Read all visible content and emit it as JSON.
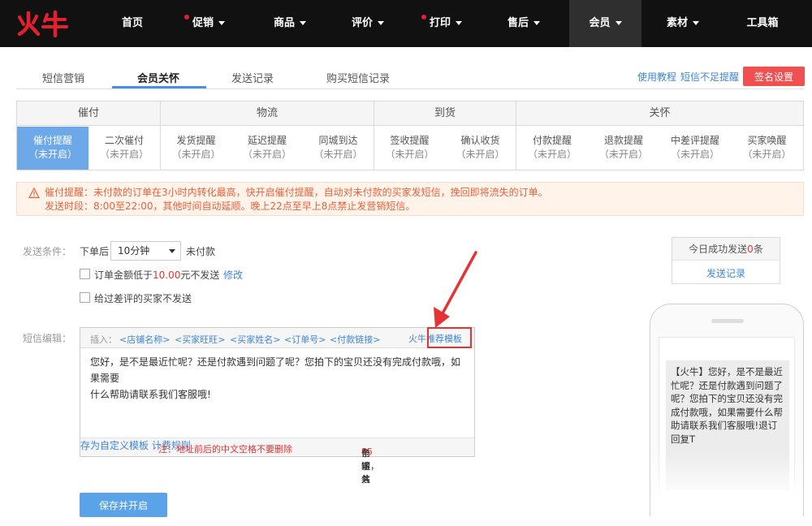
{
  "logo": {
    "text": "火牛"
  },
  "nav": {
    "items": [
      {
        "label": "首页"
      },
      {
        "label": "促销"
      },
      {
        "label": "商品"
      },
      {
        "label": "评价"
      },
      {
        "label": "打印"
      },
      {
        "label": "售后"
      },
      {
        "label": "会员"
      },
      {
        "label": "素材"
      },
      {
        "label": "工具箱"
      }
    ]
  },
  "tabs": [
    {
      "label": "短信营销"
    },
    {
      "label": "会员关怀"
    },
    {
      "label": "发送记录"
    },
    {
      "label": "购买短信记录"
    }
  ],
  "links": {
    "tutorial": "使用教程",
    "insufficient": "短信不足提醒"
  },
  "signature_button": "签名设置",
  "categories": {
    "groups": [
      {
        "name": "催付"
      },
      {
        "name": "物流"
      },
      {
        "name": "到货"
      },
      {
        "name": "关怀"
      }
    ],
    "items": [
      {
        "name": "催付提醒",
        "status": "（未开启）"
      },
      {
        "name": "二次催付",
        "status": "（未开启）"
      },
      {
        "name": "发货提醒",
        "status": "（未开启）"
      },
      {
        "name": "延迟提醒",
        "status": "（未开启）"
      },
      {
        "name": "同城到达",
        "status": "（未开启）"
      },
      {
        "name": "签收提醒",
        "status": "（未开启）"
      },
      {
        "name": "确认收货",
        "status": "（未开启）"
      },
      {
        "name": "付款提醒",
        "status": "（未开启）"
      },
      {
        "name": "退款提醒",
        "status": "（未开启）"
      },
      {
        "name": "中差评提醒",
        "status": "（未开启）"
      },
      {
        "name": "买家唤醒",
        "status": "（未开启）"
      }
    ]
  },
  "warning": {
    "line1": "催付提醒：未付款的订单在3小时内转化最高，快开启催付提醒，自动对未付款的买家发短信，挽回即将流失的订单。",
    "line2": "发送时段：8:00至22:00，其他时间自动延顺。晚上22点至早上8点禁止发营销短信。"
  },
  "form": {
    "condition_label": "发送条件：",
    "after_order": "下单后",
    "delay_value": "10分钟",
    "unpaid": "未付款",
    "amount_prefix": "订单金额低于",
    "amount_value": "10.00",
    "amount_suffix": "元不发送",
    "modify": "修改",
    "skip_bad_review": "给过差评的买家不发送",
    "sms_label": "短信编辑："
  },
  "editor": {
    "insert_label": "插入：",
    "inserts": [
      "<店铺名称>",
      "<买家旺旺>",
      "<买家姓名>",
      "<订单号>",
      "<付款链接>"
    ],
    "template_link": "火牛推荐模板",
    "content_line1": "您好，是不是最近忙呢？还是付款遇到问题了呢？您拍下的宝贝还没有完成付款哦，如果需要",
    "content_line2": "什么帮助请联系我们客服哦!",
    "save_template": "存为自定义模板",
    "note": "注：地址前后的中文空格不要删除",
    "billing_rule": "计费规则",
    "count_prefix": "已输入",
    "count_chars": "65",
    "count_mid": "个字，共",
    "count_msgs": "1",
    "count_suffix": "条短信"
  },
  "today": {
    "prefix": "今日成功发送",
    "count": "0",
    "suffix": "条",
    "link": "发送记录"
  },
  "preview": {
    "message": "【火牛】您好，是不是最近忙呢？还是付款遇到问题了呢？您拍下的宝贝还没有完成付款哦，如果需要什么帮助请联系我们客服哦!退订回复T"
  },
  "save_button": "保存并开启",
  "colors": {
    "accent": "#4a90e2",
    "danger": "#e53333",
    "nav_bg": "#111111",
    "active_cat": "#6da8e8"
  }
}
